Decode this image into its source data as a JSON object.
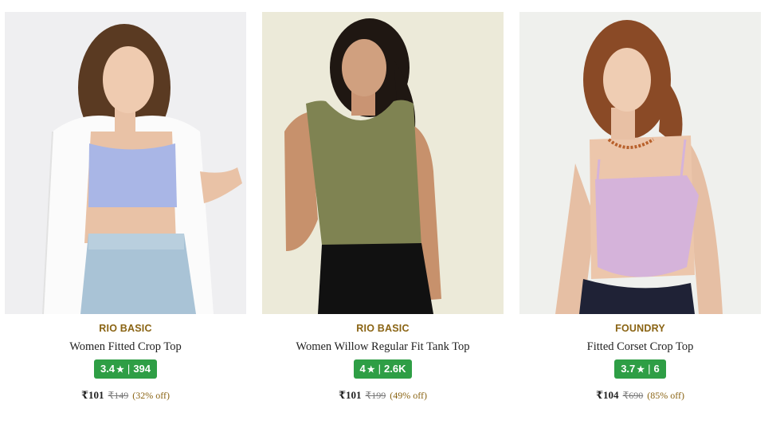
{
  "products": [
    {
      "brand": "RIO BASIC",
      "name": "Women Fitted Crop Top",
      "rating": "3.4",
      "reviews": "394",
      "price": "₹101",
      "mrp": "₹149",
      "discount": "(32% off)"
    },
    {
      "brand": "RIO BASIC",
      "name": "Women Willow Regular Fit Tank Top",
      "rating": "4",
      "reviews": "2.6K",
      "price": "₹101",
      "mrp": "₹199",
      "discount": "(49% off)"
    },
    {
      "brand": "FOUNDRY",
      "name": "Fitted Corset Crop Top",
      "rating": "3.7",
      "reviews": "6",
      "price": "₹104",
      "mrp": "₹690",
      "discount": "(85% off)"
    }
  ],
  "colors": {
    "brand_text": "#8a6414",
    "rating_badge": "#2e9e45"
  },
  "icons": {
    "rating": "star-icon",
    "brand_badge": "foundry-f-logo-icon"
  }
}
